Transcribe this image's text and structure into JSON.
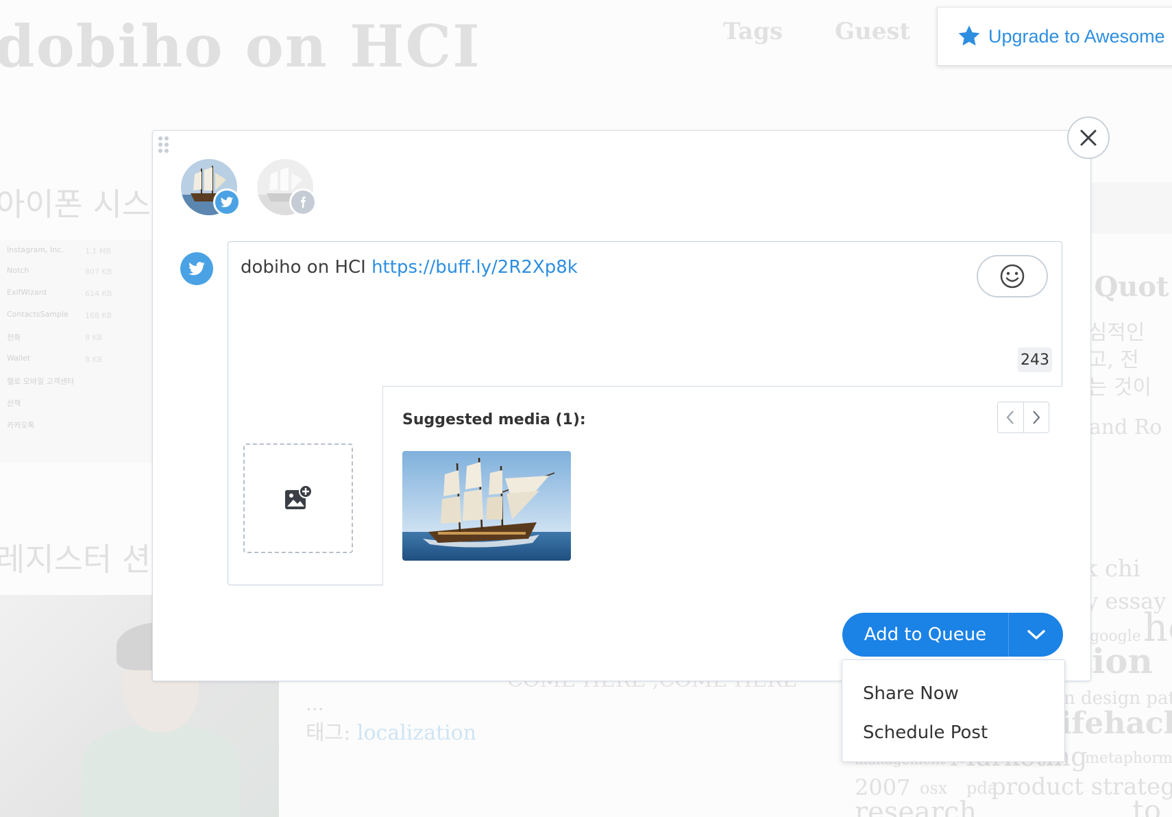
{
  "background": {
    "blog_title": "dobiho on HCI",
    "nav": [
      "Tags",
      "Guest"
    ],
    "heading1": "아이폰 시스",
    "heading2": "레지스터 션시",
    "app_list": [
      {
        "name": "Instagram, Inc.",
        "size": "1.1 MB"
      },
      {
        "name": "Notch",
        "size": "807 KB"
      },
      {
        "name": "ExifWizard",
        "size": "614 KB"
      },
      {
        "name": "ContactsSample",
        "size": "168 KB"
      },
      {
        "name": "전화",
        "size": "8 KB"
      },
      {
        "name": "Wallet",
        "size": "8 KB"
      },
      {
        "name": "헬로 모바일 고객센터",
        "size": ""
      },
      {
        "name": "산책",
        "size": ""
      },
      {
        "name": "카카오톡",
        "size": ""
      }
    ],
    "quote_heading": "s Quot",
    "korean_lines": [
      "핵심적인",
      "하고, 전",
      "나는 것이"
    ],
    "side_text": "n and Ro",
    "ellipsis": "...",
    "tag_prefix": "태그:",
    "tag_link": "localization",
    "blur_text": "COME HERE ,COME HERE",
    "tag_cloud": [
      "ok chi",
      "ay essay",
      "google",
      "ho",
      "tion",
      "n design patt",
      "lifehack m",
      "management",
      "Marketing",
      "metaphor",
      "my",
      "2007",
      "osx",
      "pda",
      "product strategy",
      "research",
      "to"
    ]
  },
  "upgrade": {
    "label": "Upgrade to Awesome"
  },
  "composer": {
    "text": "dobiho on HCI ",
    "link": "https://buff.ly/2R2Xp8k",
    "char_count": "243",
    "suggested_media_title": "Suggested media (1):"
  },
  "actions": {
    "add_to_queue": "Add to Queue",
    "menu": [
      "Share Now",
      "Schedule Post"
    ]
  },
  "colors": {
    "accent": "#1b82e6",
    "twitter": "#4aa2e4",
    "link": "#2d8ee0"
  }
}
